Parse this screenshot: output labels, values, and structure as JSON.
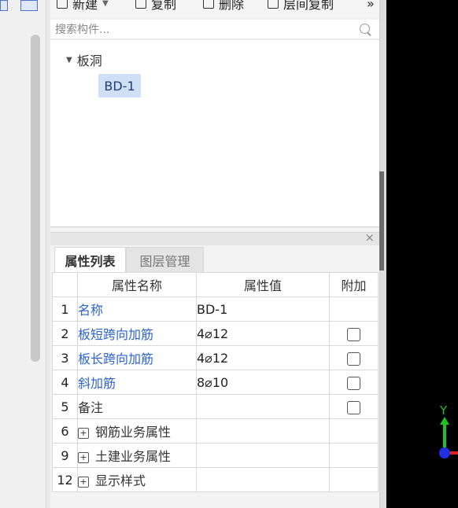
{
  "toolbar": {
    "new_label": "新建",
    "copy_label": "复制",
    "delete_label": "删除",
    "floor_copy_label": "层间复制",
    "more_label": "»"
  },
  "search": {
    "placeholder": "搜索构件..."
  },
  "tree": {
    "group_label": "板洞",
    "items": [
      {
        "label": "BD-1",
        "selected": true
      }
    ]
  },
  "property_panel": {
    "close_label": "×",
    "tabs": [
      {
        "label": "属性列表",
        "active": true
      },
      {
        "label": "图层管理",
        "active": false
      }
    ],
    "columns": [
      "属性名称",
      "属性值",
      "附加"
    ],
    "rows": [
      {
        "num": "1",
        "name": "名称",
        "value": "BD-1",
        "link": true,
        "checkbox": false
      },
      {
        "num": "2",
        "name": "板短跨向加筋",
        "value": "4⌀12",
        "link": true,
        "checkbox": true
      },
      {
        "num": "3",
        "name": "板长跨向加筋",
        "value": "4⌀12",
        "link": true,
        "checkbox": true
      },
      {
        "num": "4",
        "name": "斜加筋",
        "value": "8⌀10",
        "link": true,
        "checkbox": true
      },
      {
        "num": "5",
        "name": "备注",
        "value": "",
        "link": false,
        "checkbox": true
      },
      {
        "num": "6",
        "name": "钢筋业务属性",
        "value": "",
        "link": false,
        "checkbox": false,
        "expandable": true
      },
      {
        "num": "9",
        "name": "土建业务属性",
        "value": "",
        "link": false,
        "checkbox": false,
        "expandable": true
      },
      {
        "num": "12",
        "name": "显示样式",
        "value": "",
        "link": false,
        "checkbox": false,
        "expandable": true
      }
    ]
  },
  "viewport": {
    "axis_y_label": "Y",
    "axis_y_color": "#22c222",
    "axis_x_color": "#e02020",
    "origin_color": "#2030e0"
  },
  "colors": {
    "link": "#2b63c9",
    "selected_bg": "#cfe0f6"
  }
}
